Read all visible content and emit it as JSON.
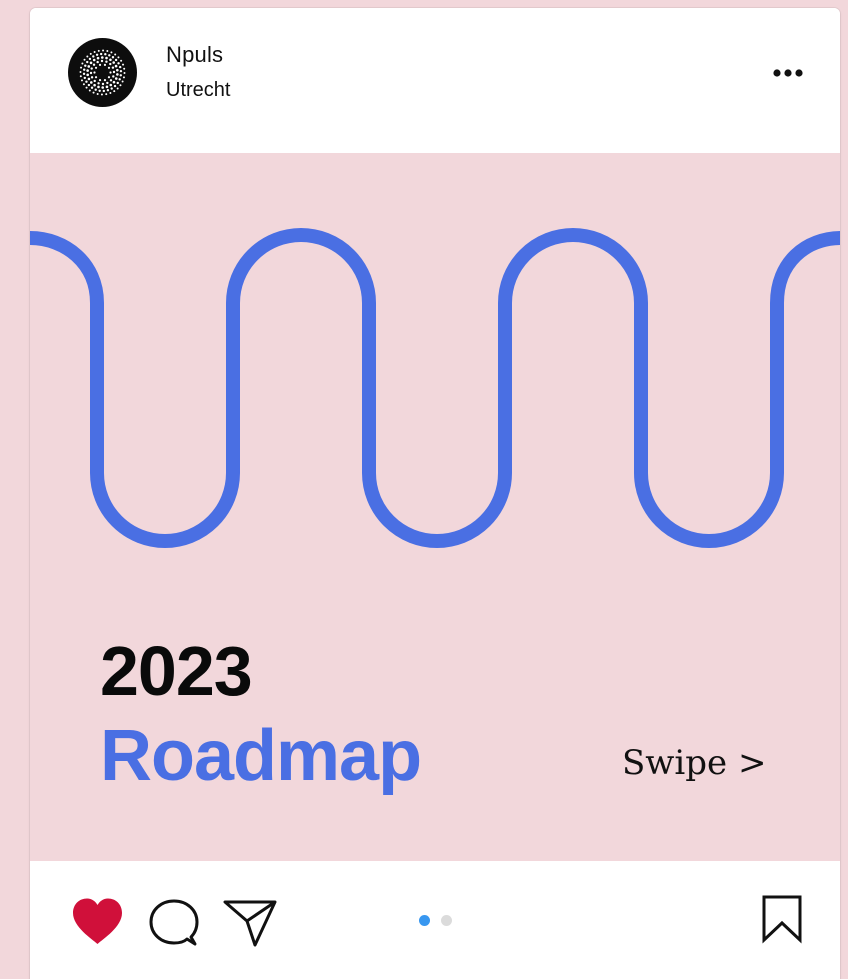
{
  "post": {
    "account_name": "Npuls",
    "location": "Utrecht",
    "more_icon": "ellipsis-icon",
    "year_text": "2023",
    "headline_text": "Roadmap",
    "swipe_text": "Swipe >"
  },
  "actions": {
    "like_icon": "heart-icon",
    "liked": true,
    "comment_icon": "comment-icon",
    "share_icon": "paper-plane-icon",
    "save_icon": "bookmark-icon"
  },
  "carousel": {
    "slide_count": 2,
    "active_index": 0
  },
  "colors": {
    "page_background": "#f2d7db",
    "accent_blue": "#4a6fe3",
    "like_red": "#d0103a",
    "dot_active": "#3897f0",
    "dot_inactive": "#dbdbdb"
  }
}
